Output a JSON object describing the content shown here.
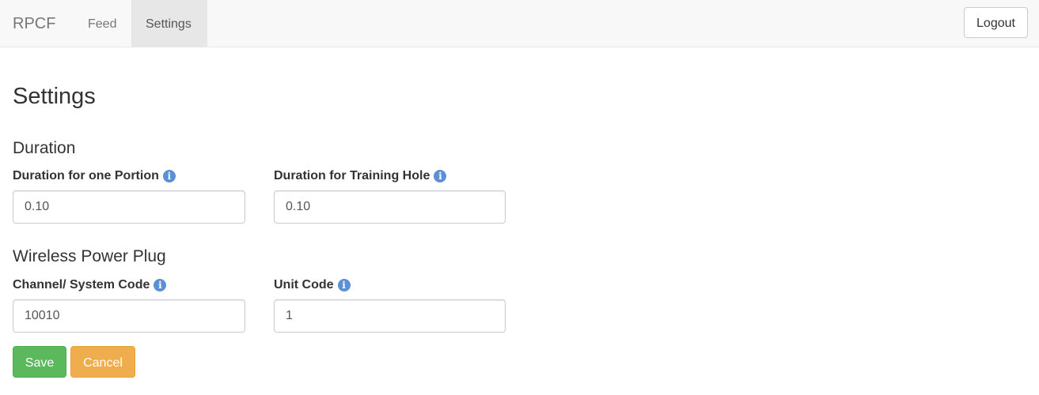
{
  "navbar": {
    "brand": "RPCF",
    "links": [
      {
        "label": "Feed",
        "active": false
      },
      {
        "label": "Settings",
        "active": true
      }
    ],
    "logout_label": "Logout"
  },
  "page": {
    "title": "Settings"
  },
  "sections": {
    "duration": {
      "title": "Duration",
      "fields": [
        {
          "label": "Duration for one Portion",
          "value": "0.10"
        },
        {
          "label": "Duration for Training Hole",
          "value": "0.10"
        }
      ]
    },
    "plug": {
      "title": "Wireless Power Plug",
      "fields": [
        {
          "label": "Channel/ System Code",
          "value": "10010"
        },
        {
          "label": "Unit Code",
          "value": "1"
        }
      ]
    }
  },
  "actions": {
    "save_label": "Save",
    "cancel_label": "Cancel"
  },
  "icons": {
    "info_glyph": "i",
    "info_color": "#5b8fd6"
  },
  "colors": {
    "save": "#5cb85c",
    "cancel": "#f0ad4e",
    "navbar_bg": "#f8f8f8",
    "active_tab_bg": "#e7e7e7"
  }
}
